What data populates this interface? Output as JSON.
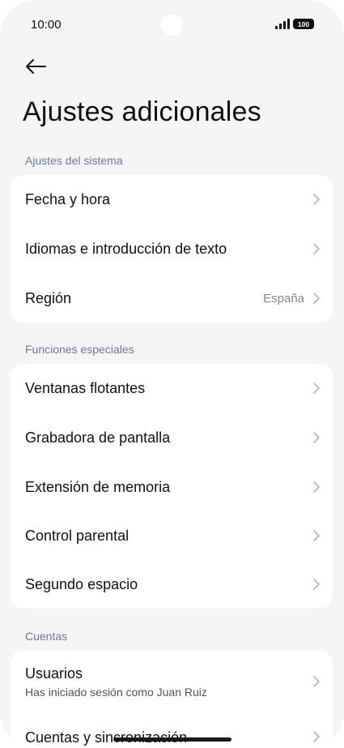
{
  "status_bar": {
    "time": "10:00",
    "battery": "100",
    "icons": [
      "signal-icon",
      "battery-icon"
    ]
  },
  "header": {
    "back_icon": "arrow-left-icon",
    "title": "Ajustes adicionales"
  },
  "sections": {
    "system": {
      "header": "Ajustes del sistema",
      "items": [
        {
          "label": "Fecha y hora"
        },
        {
          "label": "Idiomas e introducción de texto"
        },
        {
          "label": "Región",
          "value": "España"
        }
      ]
    },
    "special": {
      "header": "Funciones especiales",
      "items": [
        {
          "label": "Ventanas flotantes"
        },
        {
          "label": "Grabadora de pantalla"
        },
        {
          "label": "Extensión de memoria"
        },
        {
          "label": "Control parental"
        },
        {
          "label": "Segundo espacio"
        }
      ]
    },
    "accounts": {
      "header": "Cuentas",
      "items": [
        {
          "label": "Usuarios",
          "subtitle": "Has iniciado sesión como Juan Ruiz"
        },
        {
          "label": "Cuentas y sincronización"
        }
      ]
    }
  },
  "colors": {
    "background": "#f5f5f5",
    "card": "#ffffff",
    "section_header": "#6b7a9c",
    "chevron": "#b5b5b5"
  }
}
